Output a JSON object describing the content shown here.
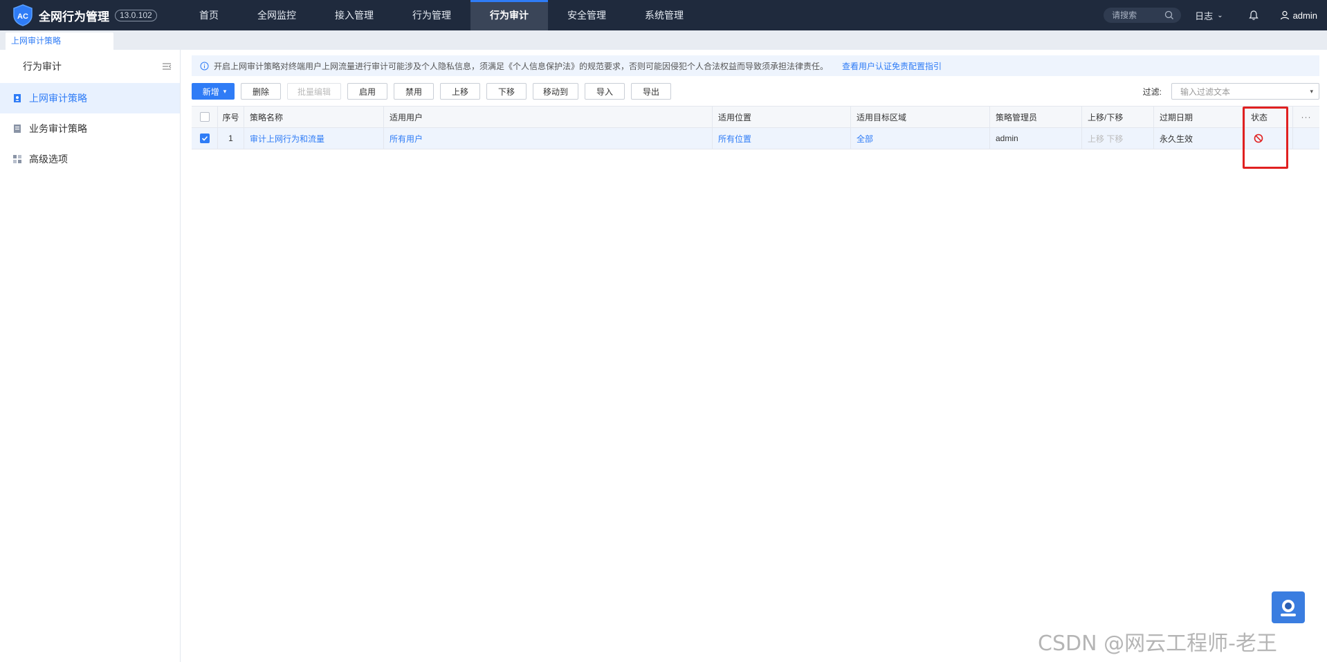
{
  "header": {
    "app_title": "全网行为管理",
    "version": "13.0.102",
    "nav": [
      {
        "label": "首页"
      },
      {
        "label": "全网监控"
      },
      {
        "label": "接入管理"
      },
      {
        "label": "行为管理"
      },
      {
        "label": "行为审计",
        "active": true
      },
      {
        "label": "安全管理"
      },
      {
        "label": "系统管理"
      }
    ],
    "search_placeholder": "请搜索",
    "log_menu": "日志",
    "username": "admin"
  },
  "breadcrumb_tab": "上网审计策略",
  "sidebar": {
    "title": "行为审计",
    "items": [
      {
        "label": "上网审计策略",
        "active": true
      },
      {
        "label": "业务审计策略"
      },
      {
        "label": "高级选项"
      }
    ]
  },
  "notice": {
    "text": "开启上网审计策略对终端用户上网流量进行审计可能涉及个人隐私信息，须满足《个人信息保护法》的规范要求，否则可能因侵犯个人合法权益而导致须承担法律责任。",
    "link": "查看用户认证免责配置指引"
  },
  "toolbar": {
    "new": "新增",
    "delete": "删除",
    "batch_edit": "批量编辑",
    "enable": "启用",
    "disable": "禁用",
    "move_up": "上移",
    "move_down": "下移",
    "move_to": "移动到",
    "import": "导入",
    "export": "导出",
    "filter_label": "过滤:",
    "filter_placeholder": "输入过滤文本"
  },
  "table": {
    "columns": [
      "序号",
      "策略名称",
      "适用用户",
      "适用位置",
      "适用目标区域",
      "策略管理员",
      "上移/下移",
      "过期日期",
      "状态"
    ],
    "more": "···",
    "rows": [
      {
        "checked": true,
        "index": "1",
        "name": "审计上网行为和流量",
        "users": "所有用户",
        "location": "所有位置",
        "target": "全部",
        "admin": "admin",
        "move_up": "上移",
        "move_down": "下移",
        "expiry": "永久生效",
        "status": "disabled"
      }
    ]
  },
  "watermark": "CSDN @网云工程师-老王",
  "colors": {
    "topbar": "#1f2a3d",
    "accent": "#2f7cf6",
    "status_disabled": "#e02020",
    "highlight": "#e02020"
  }
}
